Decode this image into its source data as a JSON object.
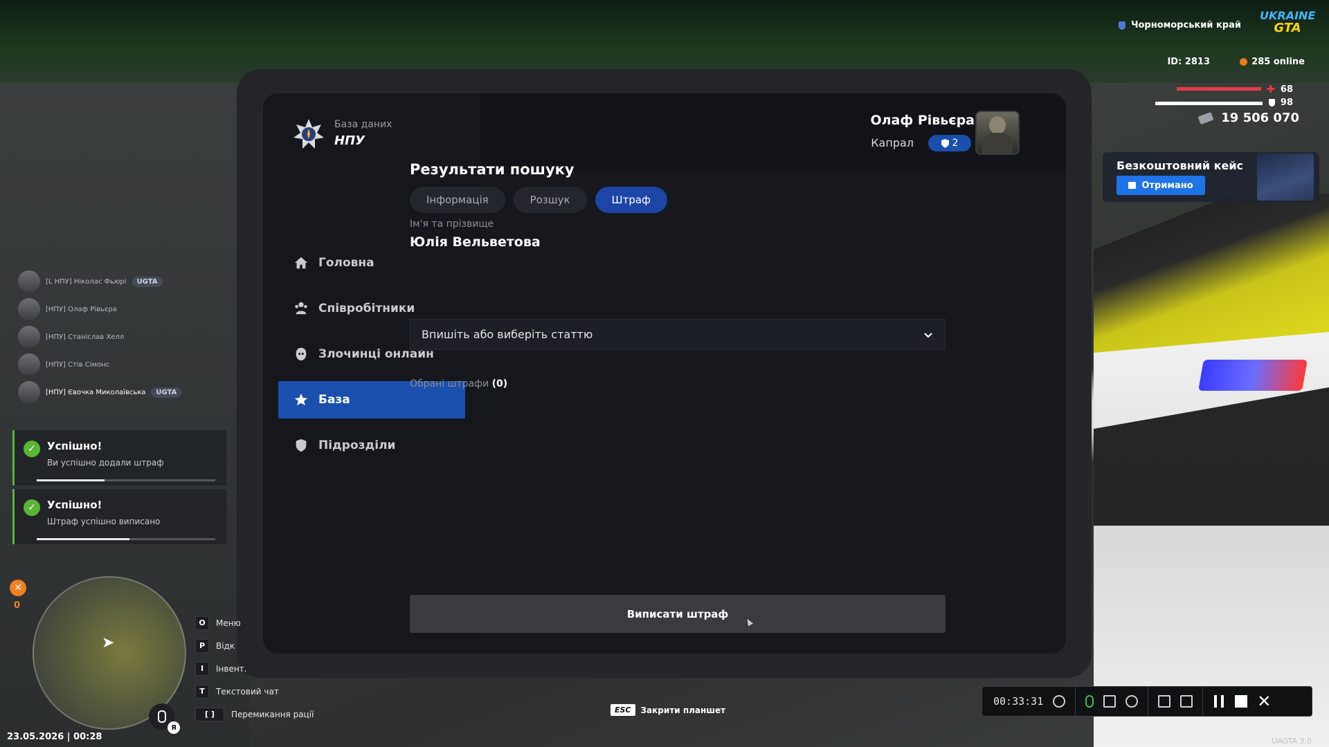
{
  "app": {
    "brand_sub": "База даних",
    "brand_title": "НПУ"
  },
  "user": {
    "name": "Олаф Рівьєра",
    "rank": "Капрал",
    "rank_level": "2"
  },
  "nav": [
    {
      "label": "Головна",
      "icon": "home-icon"
    },
    {
      "label": "Співробітники",
      "icon": "users-icon"
    },
    {
      "label": "Злочинці онлайн",
      "icon": "mask-icon"
    },
    {
      "label": "База",
      "icon": "star-icon",
      "active": true
    },
    {
      "label": "Підрозділи",
      "icon": "shield-icon"
    }
  ],
  "main": {
    "title": "Результати пошуку",
    "tabs": [
      {
        "label": "Інформація"
      },
      {
        "label": "Розшук"
      },
      {
        "label": "Штраф",
        "active": true
      }
    ],
    "name_label": "Ім'я та прізвище",
    "name_value": "Юлія Вельветова",
    "select_placeholder": "Впишіть або виберіть статтю",
    "chosen_label": "Обрані штрафи",
    "chosen_count": "(0)",
    "submit_label": "Виписати штраф"
  },
  "hud": {
    "region": "Чорноморський край",
    "logo_top": "UKRAINE",
    "logo_bottom": "GTA",
    "id": "ID: 2813",
    "online": "285 online",
    "health": "68",
    "armor": "98",
    "money": "19 506 070",
    "case_title": "Безкоштовний кейс",
    "case_button": "Отримано"
  },
  "players": [
    {
      "name": "[L НПУ] Ніколас Фьюрі",
      "tag": "UGTA"
    },
    {
      "name": "[НПУ] Олаф Рівьєра",
      "tag": ""
    },
    {
      "name": "[НПУ] Станіслав Хелл",
      "tag": ""
    },
    {
      "name": "[НПУ] Стів Сімонс",
      "tag": ""
    },
    {
      "name": "[НПУ] Євочка Миколаївська",
      "tag": "UGTA"
    }
  ],
  "toasts": [
    {
      "title": "Успішно!",
      "text": "Ви успішно додали штраф",
      "progress": 0.38
    },
    {
      "title": "Успішно!",
      "text": "Штраф успішно виписано",
      "progress": 0.52
    }
  ],
  "keys": [
    {
      "key": "O",
      "label": "Меню"
    },
    {
      "key": "P",
      "label": "Відк"
    },
    {
      "key": "I",
      "label": "Інвент."
    },
    {
      "key": "T",
      "label": "Текстовий чат"
    },
    {
      "key": "[ ]",
      "label": "Перемикання рації"
    }
  ],
  "status": {
    "hunger": "0",
    "date": "23.05.2026 | 00:28",
    "esc_key": "ESC",
    "esc_label": "Закрити планшет",
    "rec_time": "00:33:31",
    "mic_badge": "Я",
    "version": "UAGTA 3.0"
  }
}
